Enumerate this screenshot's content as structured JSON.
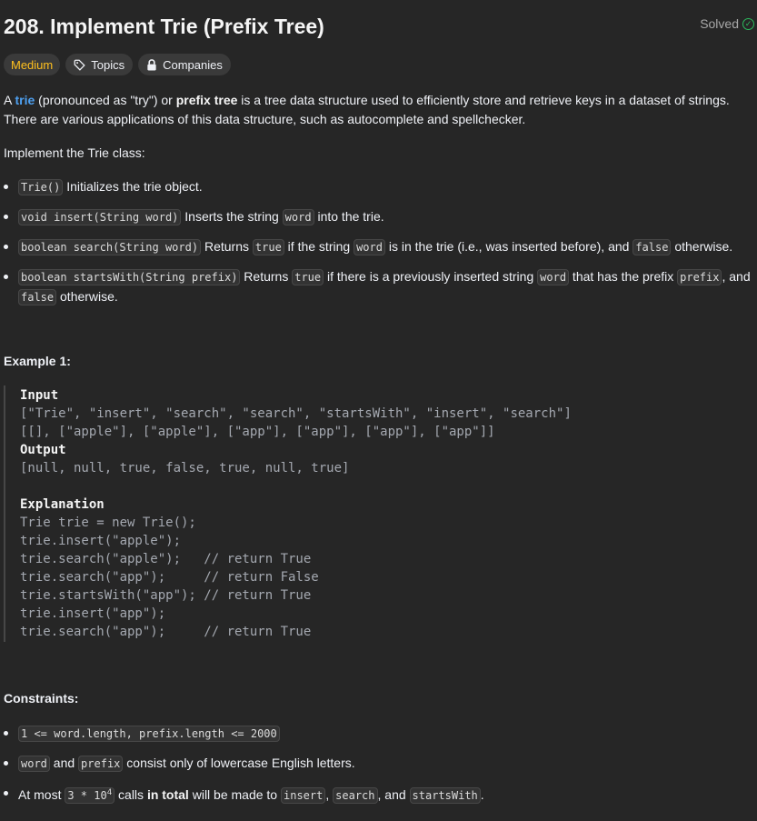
{
  "header": {
    "title": "208. Implement Trie (Prefix Tree)",
    "status": "Solved"
  },
  "tags": {
    "difficulty": "Medium",
    "topics": "Topics",
    "companies": "Companies"
  },
  "description": {
    "p1_a": "A ",
    "p1_trie": "trie",
    "p1_b": " (pronounced as \"try\") or ",
    "p1_prefix_tree": "prefix tree",
    "p1_c": " is a tree data structure used to efficiently store and retrieve keys in a dataset of strings. There are various applications of this data structure, such as autocomplete and spellchecker.",
    "p2": "Implement the Trie class:",
    "b1_code": "Trie()",
    "b1_text": " Initializes the trie object.",
    "b2_code": "void insert(String word)",
    "b2_text1": " Inserts the string ",
    "b2_code2": "word",
    "b2_text2": " into the trie.",
    "b3_code": "boolean search(String word)",
    "b3_text1": " Returns ",
    "b3_code2": "true",
    "b3_text2": " if the string ",
    "b3_code3": "word",
    "b3_text3": " is in the trie (i.e., was inserted before), and ",
    "b3_code4": "false",
    "b3_text4": " otherwise.",
    "b4_code": "boolean startsWith(String prefix)",
    "b4_text1": " Returns ",
    "b4_code2": "true",
    "b4_text2": " if there is a previously inserted string ",
    "b4_code3": "word",
    "b4_text3": " that has the prefix ",
    "b4_code4": "prefix",
    "b4_text4": ", and ",
    "b4_code5": "false",
    "b4_text5": " otherwise."
  },
  "example": {
    "title": "Example 1:",
    "input_label": "Input",
    "input_line1": "[\"Trie\", \"insert\", \"search\", \"search\", \"startsWith\", \"insert\", \"search\"]",
    "input_line2": "[[], [\"apple\"], [\"apple\"], [\"app\"], [\"app\"], [\"app\"], [\"app\"]]",
    "output_label": "Output",
    "output_line": "[null, null, true, false, true, null, true]",
    "explanation_label": "Explanation",
    "exp_lines": [
      "Trie trie = new Trie();",
      "trie.insert(\"apple\");",
      "trie.search(\"apple\");   // return True",
      "trie.search(\"app\");     // return False",
      "trie.startsWith(\"app\"); // return True",
      "trie.insert(\"app\");",
      "trie.search(\"app\");     // return True"
    ]
  },
  "constraints": {
    "title": "Constraints:",
    "c1_code": "1 <= word.length, prefix.length <= 2000",
    "c2_code1": "word",
    "c2_text1": " and ",
    "c2_code2": "prefix",
    "c2_text2": " consist only of lowercase English letters.",
    "c3_text1": "At most ",
    "c3_code_base": "3 * 10",
    "c3_code_exp": "4",
    "c3_text2": " calls ",
    "c3_bold": "in total",
    "c3_text3": " will be made to ",
    "c3_code2": "insert",
    "c3_sep1": ", ",
    "c3_code3": "search",
    "c3_sep2": ", and ",
    "c3_code4": "startsWith",
    "c3_end": "."
  },
  "colors": {
    "background": "#262626",
    "difficulty_medium": "#ffc01e",
    "link_blue": "#4ea0f0",
    "solved_green": "#2cbb5d"
  }
}
